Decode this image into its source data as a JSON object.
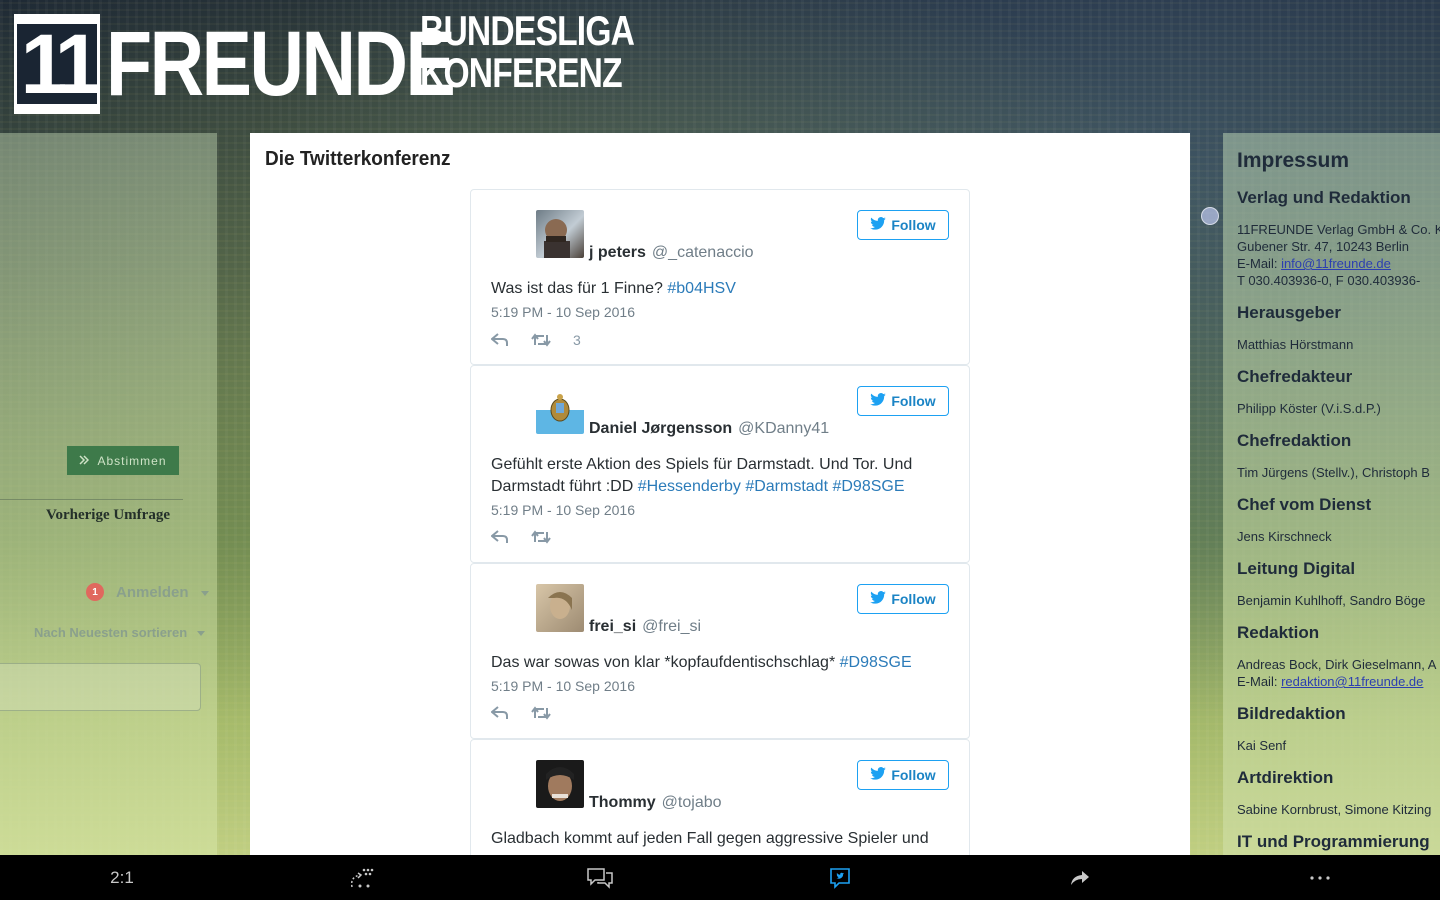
{
  "header": {
    "logo_number": "11",
    "logo_word": "FREUNDE",
    "logo_sub_line1": "BUNDESLIGA",
    "logo_sub_line2": "KONFERENZ"
  },
  "left_panel": {
    "vote_button": "Abstimmen",
    "previous_poll": "Vorherige Umfrage",
    "login_badge": "1",
    "login": "Anmelden",
    "sort": "Nach Neuesten sortieren"
  },
  "center": {
    "title": "Die Twitterkonferenz",
    "follow_label": "Follow",
    "tweets": [
      {
        "name": "j peters",
        "handle": "@_catenaccio",
        "text_plain": "Was ist das für 1 Finne? ",
        "tags": "#b04HSV",
        "time": "5:19 PM - 10 Sep 2016",
        "likes": "3"
      },
      {
        "name": "Daniel Jørgensson",
        "handle": "@KDanny41",
        "text_plain": "Gefühlt erste Aktion des Spiels für Darmstadt. Und Tor. Und Darmstadt führt :DD ",
        "tags": "#Hessenderby #Darmstadt #D98SGE",
        "time": "5:19 PM - 10 Sep 2016",
        "likes": ""
      },
      {
        "name": "frei_si",
        "handle": "@frei_si",
        "text_plain": "Das war sowas von klar *kopfaufdentischschlag* ",
        "tags": "#D98SGE",
        "time": "5:19 PM - 10 Sep 2016",
        "likes": ""
      },
      {
        "name": "Thommy",
        "handle": "@tojabo",
        "text_plain": "Gladbach kommt auf jeden Fall gegen aggressive Spieler und",
        "tags": "",
        "time": "",
        "likes": ""
      }
    ]
  },
  "right_panel": {
    "title": "Impressum",
    "verlag_head": "Verlag und Redaktion",
    "verlag_line1": "11FREUNDE Verlag GmbH & Co. K",
    "verlag_line2": "Gubener Str. 47, 10243 Berlin",
    "verlag_email_label": "E-Mail: ",
    "verlag_email": "info@11freunde.de",
    "verlag_phone": "T 030.403936-0, F 030.403936-",
    "herausgeber_head": "Herausgeber",
    "herausgeber": "Matthias Hörstmann",
    "chefredakteur_head": "Chefredakteur",
    "chefredakteur": "Philipp Köster (V.i.S.d.P.)",
    "chefredaktion_head": "Chefredaktion",
    "chefredaktion": "Tim Jürgens (Stellv.), Christoph B",
    "cvd_head": "Chef vom Dienst",
    "cvd": "Jens Kirschneck",
    "digital_head": "Leitung Digital",
    "digital": "Benjamin Kuhlhoff, Sandro Böge",
    "redaktion_head": "Redaktion",
    "redaktion": "Andreas Bock, Dirk Gieselmann, A",
    "redaktion_email_label": "E-Mail: ",
    "redaktion_email": "redaktion@11freunde.de",
    "bild_head": "Bildredaktion",
    "bild": "Kai Senf",
    "art_head": "Artdirektion",
    "art": "Sabine Kornbrust, Simone Kitzing",
    "it_head": "IT und Programmierung"
  },
  "bottom_bar": {
    "ratio": "2:1"
  }
}
